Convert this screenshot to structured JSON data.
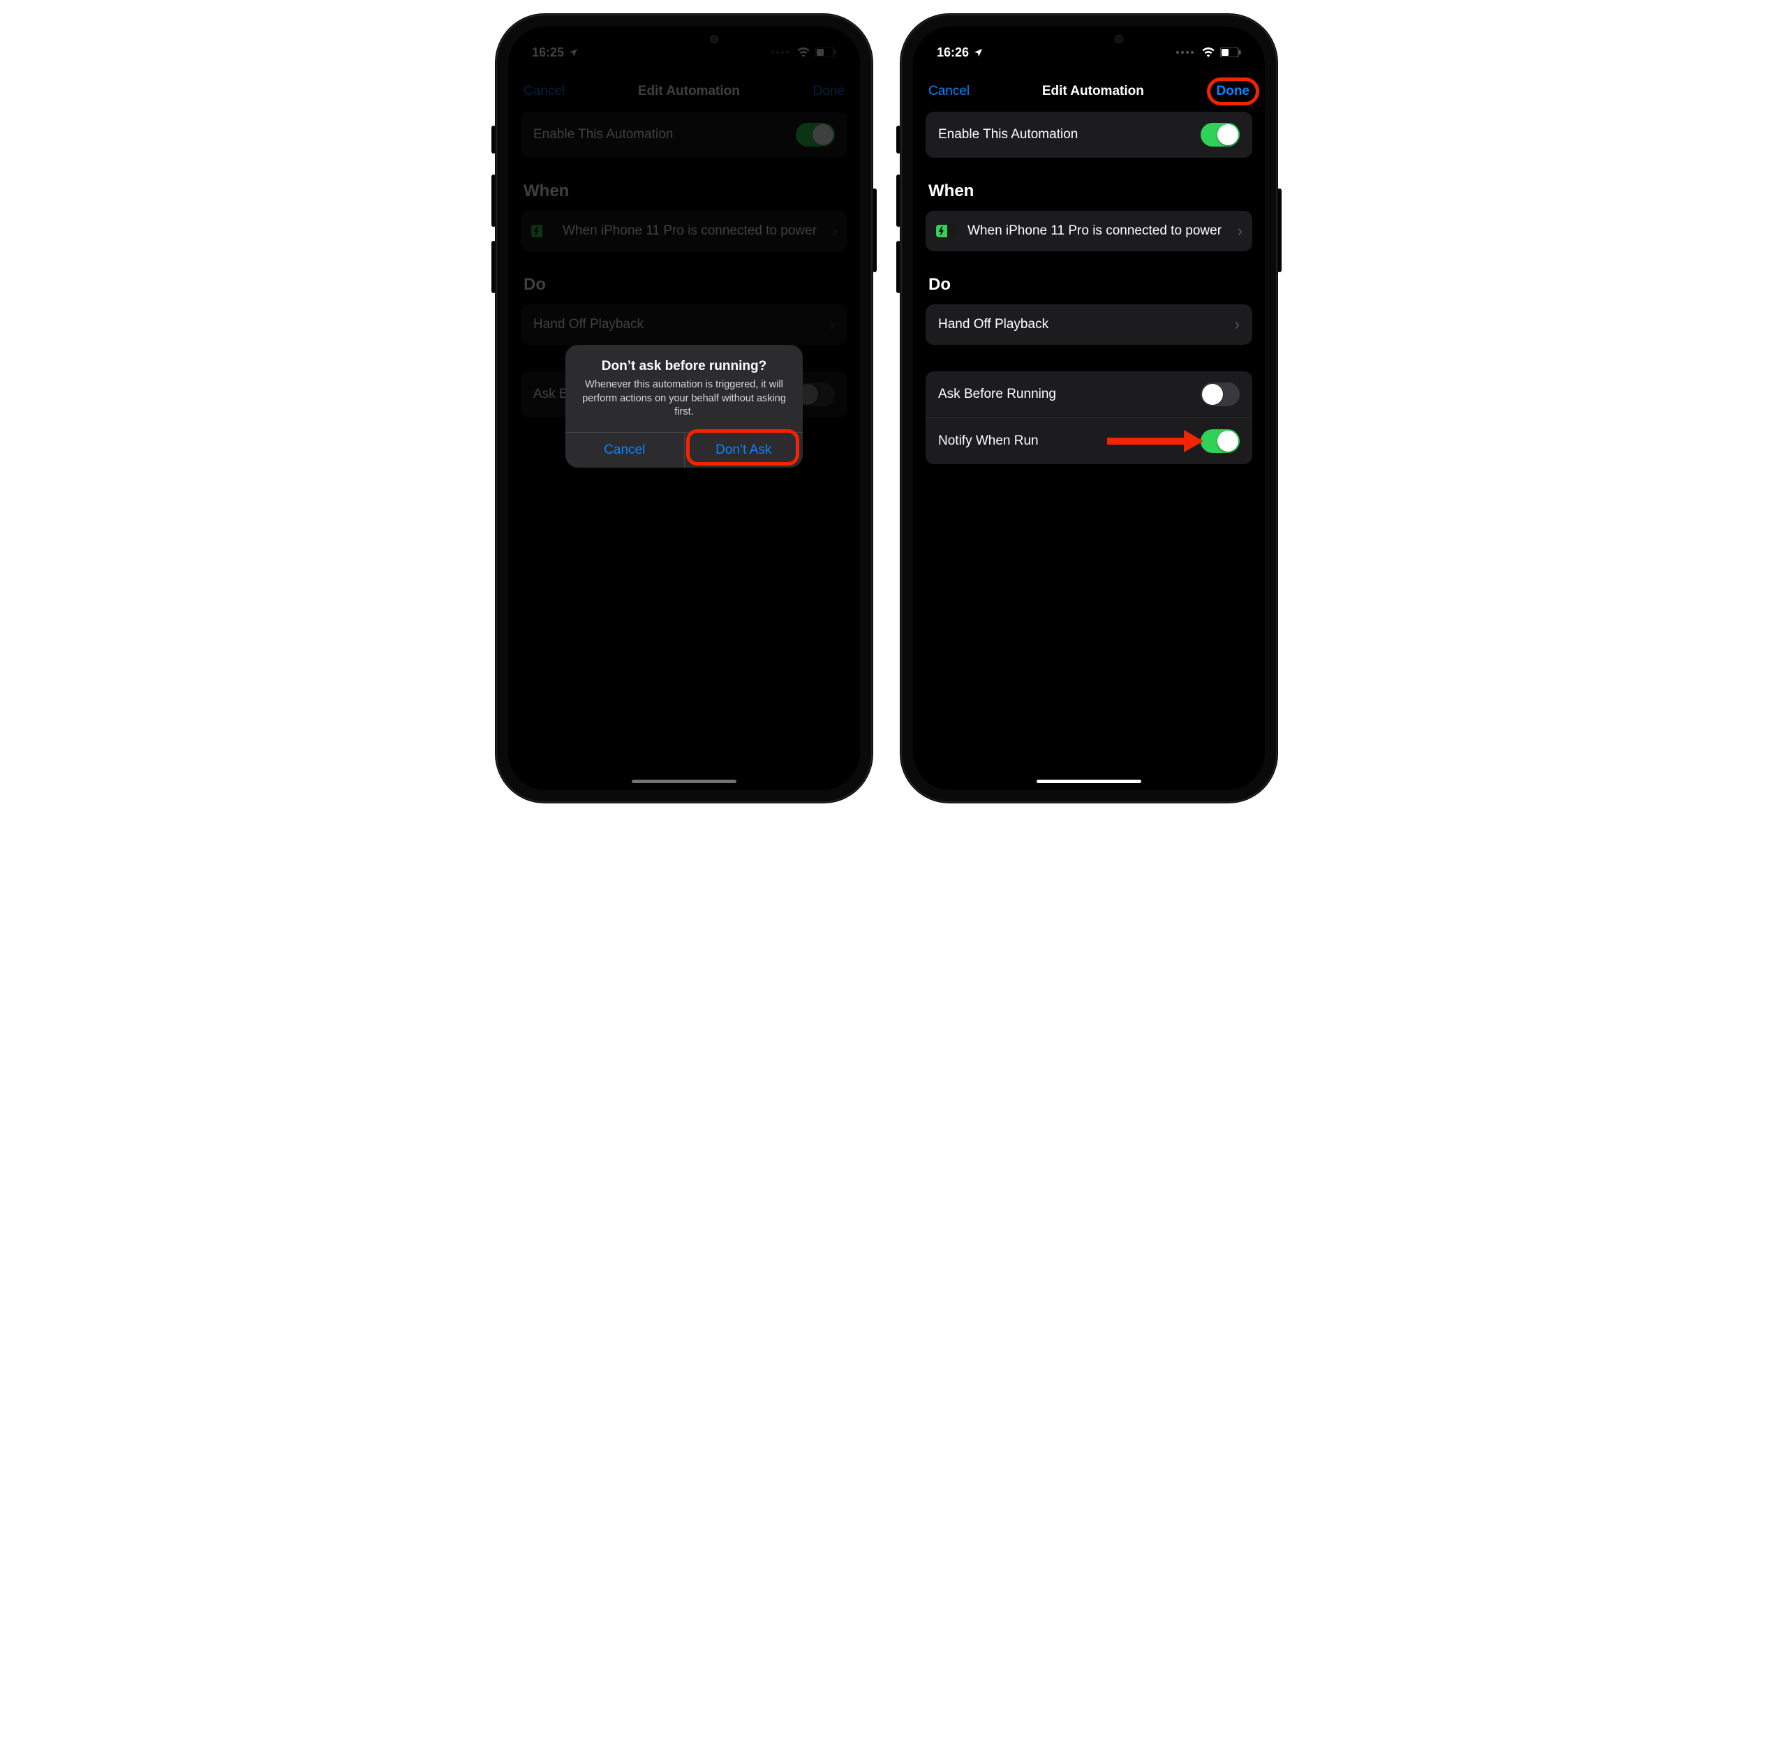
{
  "left": {
    "status_time": "16:25",
    "nav_cancel": "Cancel",
    "nav_title": "Edit Automation",
    "nav_done": "Done",
    "enable_label": "Enable This Automation",
    "section_when": "When",
    "when_text": "When iPhone 11 Pro is connected to power",
    "section_do": "Do",
    "do_action": "Hand Off Playback",
    "ask_label": "Ask Before Running",
    "alert_title": "Don’t ask before running?",
    "alert_msg": "Whenever this automation is triggered, it will perform actions on your behalf without asking first.",
    "alert_cancel": "Cancel",
    "alert_confirm": "Don’t Ask"
  },
  "right": {
    "status_time": "16:26",
    "nav_cancel": "Cancel",
    "nav_title": "Edit Automation",
    "nav_done": "Done",
    "enable_label": "Enable This Automation",
    "section_when": "When",
    "when_text": "When iPhone 11 Pro is connected to power",
    "section_do": "Do",
    "do_action": "Hand Off Playback",
    "ask_label": "Ask Before Running",
    "notify_label": "Notify When Run"
  }
}
